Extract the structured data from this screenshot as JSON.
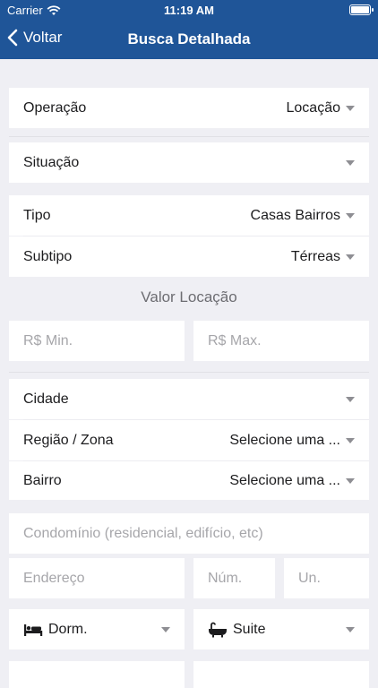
{
  "status_bar": {
    "carrier": "Carrier",
    "time": "11:19 AM"
  },
  "nav": {
    "back_label": "Voltar",
    "title": "Busca Detalhada"
  },
  "fields": {
    "operacao": {
      "label": "Operação",
      "value": "Locação"
    },
    "situacao": {
      "label": "Situação",
      "value": ""
    },
    "tipo": {
      "label": "Tipo",
      "value": "Casas Bairros"
    },
    "subtipo": {
      "label": "Subtipo",
      "value": "Térreas"
    },
    "valor_title": "Valor Locação",
    "valor_min_placeholder": "R$ Min.",
    "valor_max_placeholder": "R$ Max.",
    "cidade": {
      "label": "Cidade",
      "value": ""
    },
    "regiao": {
      "label": "Região / Zona",
      "value": "Selecione uma ..."
    },
    "bairro": {
      "label": "Bairro",
      "value": "Selecione uma ..."
    },
    "condominio_placeholder": "Condomínio (residencial, edifício, etc)",
    "endereco_placeholder": "Endereço",
    "num_placeholder": "Núm.",
    "un_placeholder": "Un.",
    "dorm": {
      "label": "Dorm.",
      "icon": "bed-icon"
    },
    "suite": {
      "label": "Suite",
      "icon": "bathtub-icon"
    }
  }
}
